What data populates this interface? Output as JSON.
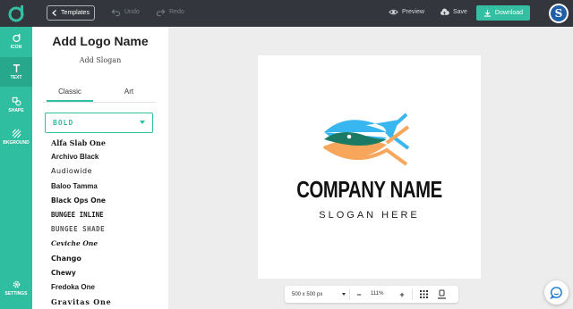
{
  "topbar": {
    "templates_label": "Templates",
    "undo_label": "Undo",
    "redo_label": "Redo",
    "preview_label": "Preview",
    "save_label": "Save",
    "download_label": "Download",
    "avatar_letter": "S"
  },
  "rail": {
    "items": [
      {
        "label": "ICON",
        "icon": "icon-icon"
      },
      {
        "label": "TEXT",
        "icon": "text-icon",
        "active": true
      },
      {
        "label": "SHAPE",
        "icon": "shape-icon"
      },
      {
        "label": "BKGROUND",
        "icon": "background-icon"
      },
      {
        "label": "SETTINGS",
        "icon": "gear-icon"
      }
    ]
  },
  "panel": {
    "title": "Add Logo Name",
    "subtitle": "Add Slogan",
    "tabs": [
      "Classic",
      "Art"
    ],
    "active_tab": "Classic",
    "font_category": "BOLD",
    "fonts": [
      "Alfa Slab One",
      "Archivo Black",
      "Audiowide",
      "Baloo Tamma",
      "Black Ops One",
      "BUNGEE INLINE",
      "BUNGEE SHADE",
      "Ceviche One",
      "Chango",
      "Chewy",
      "Fredoka One",
      "Gravitas One"
    ]
  },
  "canvas": {
    "company_name": "COMPANY NAME",
    "slogan": "SLOGAN HERE",
    "colors": {
      "fish_top": "#38b6f0",
      "fish_bottom": "#f7a65b",
      "fish_overlap": "#1a7a63"
    }
  },
  "bottombar": {
    "size_label": "500 x 500 px",
    "zoom_label": "111%"
  },
  "colors": {
    "accent": "#34bfa3",
    "topbar": "#33373d"
  }
}
